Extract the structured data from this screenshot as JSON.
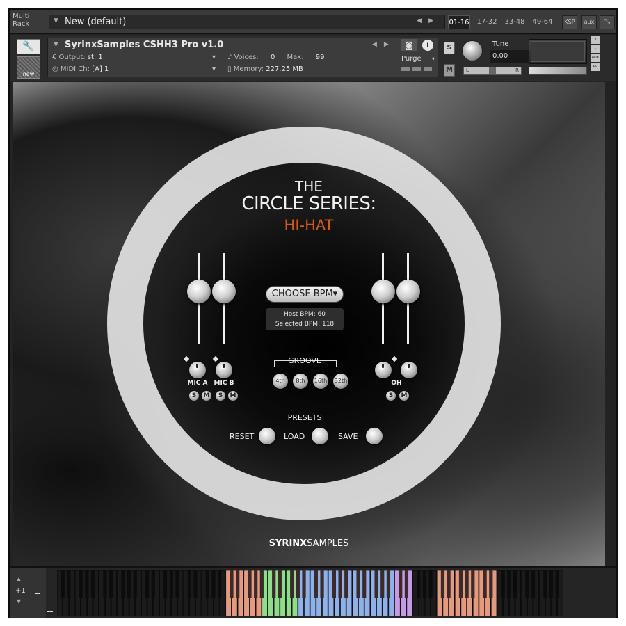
{
  "rack": {
    "label_line1": "Multi",
    "label_line2": "Rack",
    "preset_name": "New (default)",
    "page_tabs": [
      "01-16",
      "17-32",
      "33-48",
      "49-64"
    ],
    "active_tab": "01-16",
    "ksp_label": "KSP",
    "aux_label": "aux"
  },
  "instrument": {
    "title": "SyrinxSamples CSHH3 Pro v1.0",
    "output_label": "Output:",
    "output_value": "st. 1",
    "midi_label": "MIDI Ch:",
    "midi_value": "[A]  1",
    "voices_label": "Voices:",
    "voices_value": "0",
    "max_label": "Max:",
    "max_value": "99",
    "memory_label": "Memory:",
    "memory_value": "227.25 MB",
    "purge_label": "Purge",
    "solo_label": "S",
    "mute_label": "M",
    "tune_label": "Tune",
    "tune_value": "0.00",
    "pan_left": "L",
    "pan_right": "R",
    "new_label": "new",
    "side_buttons": [
      "x",
      "-",
      "AUX",
      "PV"
    ]
  },
  "panel": {
    "title_the": "THE",
    "title_series": "CIRCLE SERIES:",
    "title_product": "HI-HAT",
    "choose_bpm": "CHOOSE BPM▾",
    "host_bpm": "Host BPM: 60",
    "selected_bpm": "Selected BPM: 118",
    "mic_a": "MIC A",
    "mic_b": "MIC B",
    "oh": "OH",
    "solo": "S",
    "mute": "M",
    "groove_label": "GROOVE",
    "groove_options": [
      "4th",
      "8th",
      "16th",
      "32th"
    ],
    "presets_label": "PRESETS",
    "reset_label": "RESET",
    "load_label": "LOAD",
    "save_label": "SAVE",
    "brand_bold": "SYRINX",
    "brand_light": "SAMPLES"
  },
  "keyboard": {
    "octave_value": "+1",
    "zone_colors": {
      "orange": "#e39a7f",
      "green": "#8fdc8a",
      "blue": "#8fb1e8",
      "purple": "#c69be6",
      "dark": "#1b1b1b"
    }
  },
  "colors": {
    "accent_orange": "#d5581c"
  }
}
